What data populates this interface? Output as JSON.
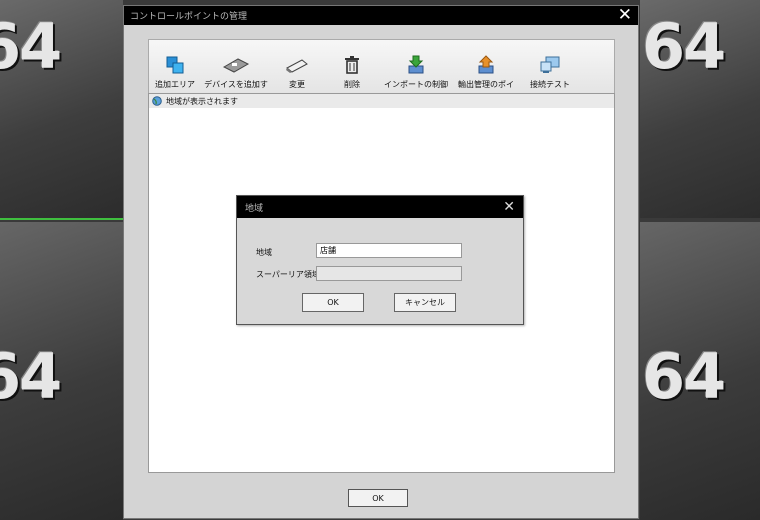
{
  "background": {
    "digits": [
      "64",
      "64",
      "64",
      "64"
    ]
  },
  "main_window": {
    "title": "コントロールポイントの管理",
    "toolbar": [
      {
        "label": "追加エリア",
        "icon": "add-area-icon"
      },
      {
        "label": "デバイスを追加す",
        "icon": "add-device-icon"
      },
      {
        "label": "変更",
        "icon": "edit-icon"
      },
      {
        "label": "削除",
        "icon": "trash-icon"
      },
      {
        "label": "インポートの制御",
        "icon": "import-icon"
      },
      {
        "label": "輸出管理のポイ",
        "icon": "export-icon"
      },
      {
        "label": "接続テスト",
        "icon": "connection-test-icon"
      }
    ],
    "tree_root": "地域が表示されます",
    "ok_label": "OK"
  },
  "dialog": {
    "title": "地域",
    "region_label": "地域",
    "region_value": "店舗",
    "super_region_label": "スーパーリア領域",
    "super_region_value": "",
    "ok_label": "OK",
    "cancel_label": "キャンセル"
  },
  "colors": {
    "titlebar": "#000000",
    "window_bg": "#d4d4d4",
    "accent_green": "#3fbf3f"
  }
}
